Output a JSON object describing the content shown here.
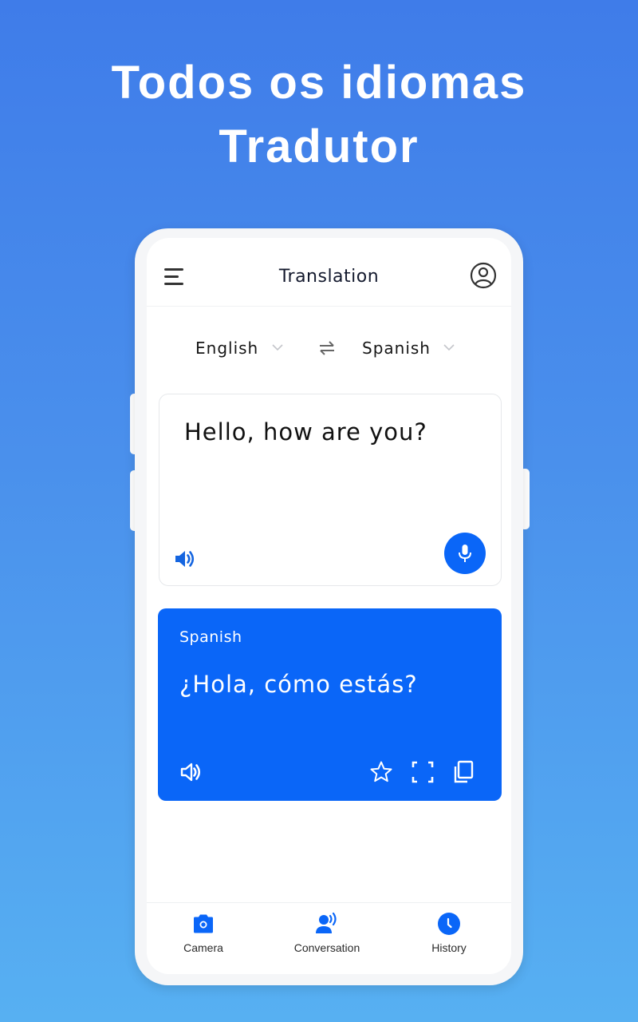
{
  "promo": {
    "headline_line1": "Todos os idiomas",
    "headline_line2": "Tradutor"
  },
  "appbar": {
    "title": "Translation",
    "menu_icon": "hamburger-menu-icon",
    "account_icon": "account-circle-icon"
  },
  "languages": {
    "source": "English",
    "target": "Spanish",
    "swap_icon": "swap-arrows-icon",
    "dropdown_icon": "chevron-down-icon"
  },
  "input": {
    "text": "Hello, how are you?",
    "speaker_icon": "speaker-icon",
    "mic_icon": "microphone-icon"
  },
  "output": {
    "language_label": "Spanish",
    "text": "¿Hola, cómo estás?",
    "icons": [
      "speaker-icon",
      "star-icon",
      "fullscreen-icon",
      "copy-icon"
    ]
  },
  "bottom_nav": {
    "items": [
      {
        "label": "Camera",
        "icon": "camera-icon"
      },
      {
        "label": "Conversation",
        "icon": "conversation-icon"
      },
      {
        "label": "History",
        "icon": "clock-icon"
      }
    ]
  },
  "colors": {
    "accent": "#0a66f8",
    "background_top": "#3f7ce9",
    "background_bottom": "#57b0f2",
    "title_text": "#141a2e"
  }
}
